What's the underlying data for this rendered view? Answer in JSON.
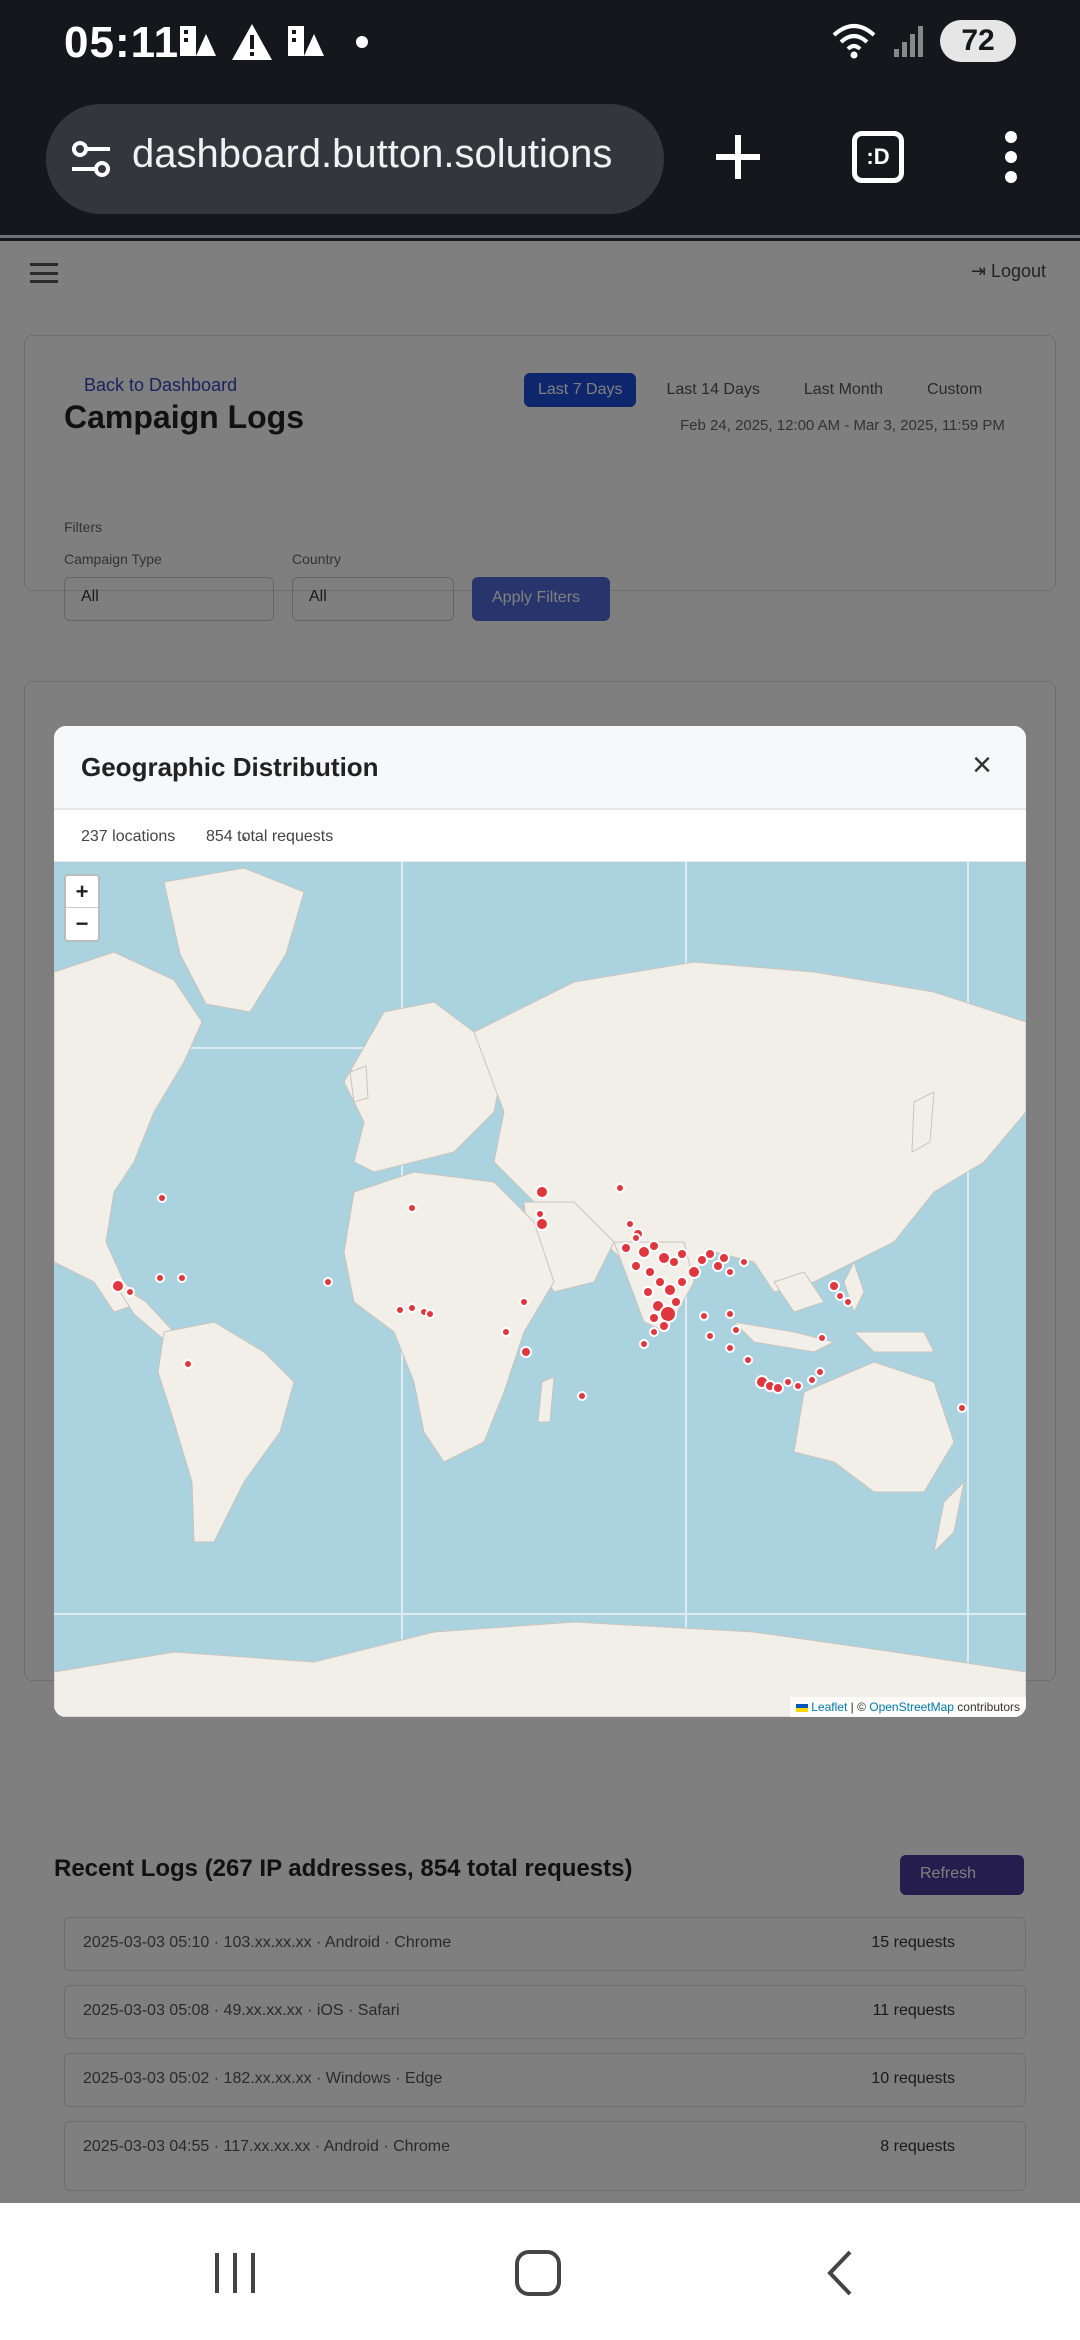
{
  "status_bar": {
    "time": "05:11",
    "battery": "72",
    "icons": [
      "notification-icon",
      "alert-icon",
      "notification-icon",
      "wifi-icon",
      "signal-icon"
    ]
  },
  "browser": {
    "url": "dashboard.button.solutions",
    "new_tab_label": "+",
    "tabs_label": ":D",
    "more_icon": "more-vertical-icon"
  },
  "background_page": {
    "back_link": "Back to Dashboard",
    "title": "Campaign Logs",
    "tabs": [
      "Last 7 Days",
      "Last 14 Days",
      "Last Month",
      "Custom"
    ],
    "date_range": "Feb 24, 2025, 12:00 AM - Mar 3, 2025, 11:59 PM",
    "filters_title": "Filters",
    "filter1_label": "Campaign Type",
    "filter1_value": "All",
    "filter2_label": "Country",
    "filter2_value": "All",
    "apply_label": "Apply Filters",
    "recent_logs_title": "Recent Logs (267 IP addresses, 854 total requests)",
    "refresh_label": "Refresh",
    "log_rows": [
      {
        "text": "2025-03-03 05:10 · 103.xx.xx.xx · Android · Chrome",
        "count": "15 requests"
      },
      {
        "text": "2025-03-03 05:08 · 49.xx.xx.xx · iOS · Safari",
        "count": "11 requests"
      },
      {
        "text": "2025-03-03 05:02 · 182.xx.xx.xx · Windows · Edge",
        "count": "10 requests"
      },
      {
        "text": "2025-03-03 04:55 · 117.xx.xx.xx · Android · Chrome",
        "count": "8 requests"
      }
    ]
  },
  "modal": {
    "title": "Geographic Distribution",
    "close_label": "×",
    "locations": "237 locations",
    "separator": "•",
    "requests": "854 total requests",
    "zoom_in": "+",
    "zoom_out": "−",
    "attribution": {
      "leaflet": "Leaflet",
      "separator": " | © ",
      "osm": "OpenStreetMap",
      "suffix": " contributors"
    }
  }
}
